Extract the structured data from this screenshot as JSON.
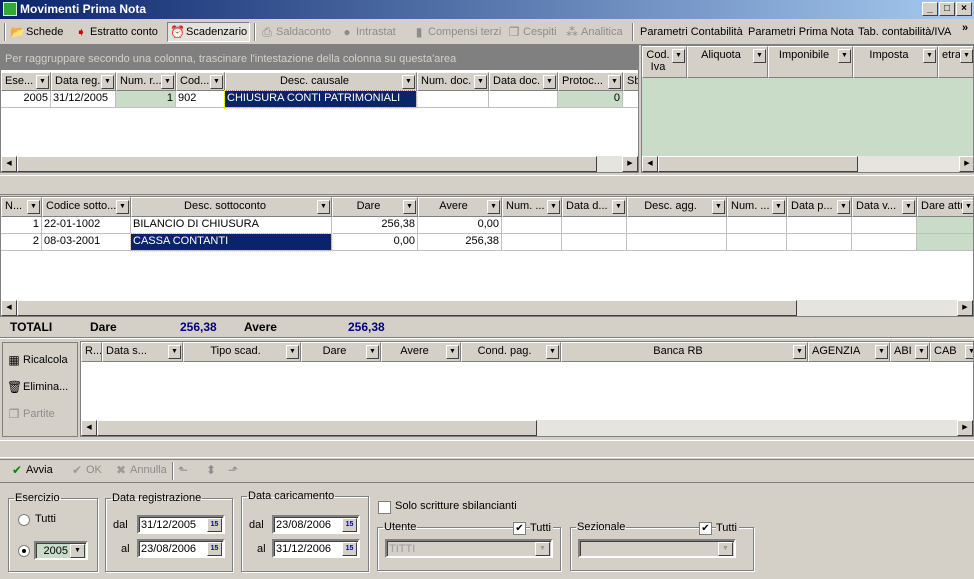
{
  "window": {
    "title": "Movimenti Prima Nota"
  },
  "toolbar": [
    {
      "label": "Schede",
      "icon": "folder-icon",
      "enabled": true
    },
    {
      "label": "Estratto conto",
      "icon": "document-arrow-icon",
      "enabled": true
    },
    {
      "label": "Scadenzario",
      "icon": "alarm-clock-icon",
      "enabled": true,
      "pressed": true
    },
    {
      "label": "Saldaconto",
      "icon": "printer-icon",
      "enabled": false
    },
    {
      "label": "Intrastat",
      "icon": "globe-icon",
      "enabled": false
    },
    {
      "label": "Compensi terzi",
      "icon": "book-icon",
      "enabled": false
    },
    {
      "label": "Cespiti",
      "icon": "pages-icon",
      "enabled": false
    },
    {
      "label": "Analitica",
      "icon": "network-icon",
      "enabled": false
    },
    {
      "label": "Parametri Contabilità",
      "enabled": true
    },
    {
      "label": "Parametri Prima Nota",
      "enabled": true
    },
    {
      "label": "Tab. contabilità/IVA",
      "enabled": true
    }
  ],
  "top_grid": {
    "group_hint": "Per raggruppare secondo una colonna, trascinare l'intestazione della colonna su questa'area",
    "columns": [
      "Ese...",
      "Data reg.",
      "Num. r...",
      "Cod...",
      "Desc. causale",
      "Num. doc.",
      "Data doc.",
      "Protoc...",
      "Sb"
    ],
    "rows": [
      [
        "2005",
        "31/12/2005",
        "1",
        "902",
        "CHIUSURA CONTI PATRIMONIALI",
        "",
        "",
        "0",
        ""
      ]
    ]
  },
  "iva_grid": {
    "columns": [
      "Cod. Iva",
      "Aliquota",
      "Imponibile",
      "Imposta",
      "etraibi"
    ]
  },
  "righe_grid": {
    "columns": [
      "N...",
      "Codice sotto...",
      "Desc. sottoconto",
      "Dare",
      "Avere",
      "Num. ...",
      "Data d...",
      "Desc. agg.",
      "Num. ...",
      "Data p...",
      "Data v...",
      "Dare attua"
    ],
    "rows": [
      [
        "1",
        "22-01-1002",
        "BILANCIO DI CHIUSURA",
        "256,38",
        "0,00",
        "",
        "",
        "",
        "",
        "",
        "",
        ""
      ],
      [
        "2",
        "08-03-2001",
        "CASSA CONTANTI",
        "0,00",
        "256,38",
        "",
        "",
        "",
        "",
        "",
        "",
        ""
      ]
    ]
  },
  "totali": {
    "label": "TOTALI",
    "dare_label": "Dare",
    "dare": "256,38",
    "avere_label": "Avere",
    "avere": "256,38",
    "value_color": "#000080"
  },
  "side_buttons": [
    {
      "label": "Ricalcola",
      "icon": "calculator-icon",
      "enabled": true
    },
    {
      "label": "Elimina...",
      "icon": "trash-icon",
      "enabled": true
    },
    {
      "label": "Partite",
      "icon": "pages-icon",
      "enabled": false
    }
  ],
  "scad_grid": {
    "columns": [
      "R...",
      "Data s...",
      "Tipo scad.",
      "Dare",
      "Avere",
      "Cond. pag.",
      "Banca RB",
      "AGENZIA",
      "ABI",
      "CAB"
    ]
  },
  "actions": [
    {
      "label": "Avvia",
      "icon": "checkmark-icon",
      "enabled": true
    },
    {
      "label": "OK",
      "icon": "checkmark-icon",
      "enabled": false
    },
    {
      "label": "Annulla",
      "icon": "x-icon",
      "enabled": false
    }
  ],
  "filters": {
    "esercizio": {
      "legend": "Esercizio",
      "tutti": "Tutti",
      "value": "2005",
      "selected": "year"
    },
    "data_reg": {
      "legend": "Data registrazione",
      "dal_label": "dal",
      "dal": "31/12/2005",
      "al_label": "al",
      "al": "23/08/2006"
    },
    "data_car": {
      "legend": "Data caricamento",
      "dal_label": "dal",
      "dal": "23/08/2006",
      "al_label": "al",
      "al": "31/12/2006"
    },
    "solo_sbilancianti": {
      "label": "Solo scritture sbilancianti",
      "checked": false
    },
    "utente": {
      "legend": "Utente",
      "tutti": "Tutti",
      "tutti_checked": true,
      "value": "TITTI"
    },
    "sezionale": {
      "legend": "Sezionale",
      "tutti": "Tutti",
      "tutti_checked": true,
      "value": ""
    },
    "calendar_label": "15"
  },
  "colors": {
    "selection": "#0a246a",
    "readonly_cell": "#c8dcc8",
    "title_bar": "#0a246a"
  }
}
